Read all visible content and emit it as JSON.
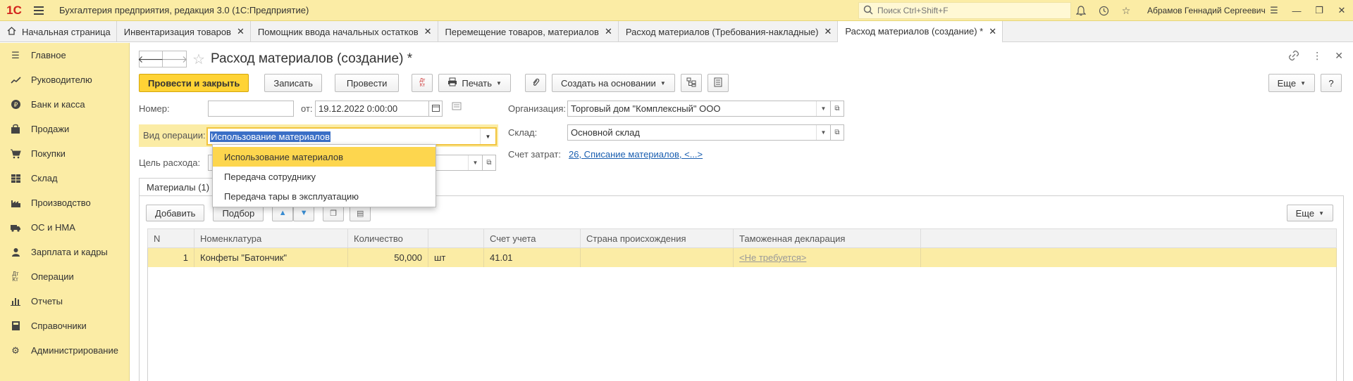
{
  "app": {
    "logo": "1С",
    "title": "Бухгалтерия предприятия, редакция 3.0  (1С:Предприятие)",
    "search_placeholder": "Поиск Ctrl+Shift+F",
    "user": "Абрамов Геннадий Сергеевич"
  },
  "tabs": [
    {
      "label": "Начальная страница"
    },
    {
      "label": "Инвентаризация товаров"
    },
    {
      "label": "Помощник ввода начальных остатков"
    },
    {
      "label": "Перемещение товаров, материалов"
    },
    {
      "label": "Расход материалов (Требования-накладные)"
    },
    {
      "label": "Расход материалов (создание) *"
    }
  ],
  "sidebar": {
    "items": [
      {
        "label": "Главное"
      },
      {
        "label": "Руководителю"
      },
      {
        "label": "Банк и касса"
      },
      {
        "label": "Продажи"
      },
      {
        "label": "Покупки"
      },
      {
        "label": "Склад"
      },
      {
        "label": "Производство"
      },
      {
        "label": "ОС и НМА"
      },
      {
        "label": "Зарплата и кадры"
      },
      {
        "label": "Операции"
      },
      {
        "label": "Отчеты"
      },
      {
        "label": "Справочники"
      },
      {
        "label": "Администрирование"
      }
    ]
  },
  "doc": {
    "title": "Расход материалов (создание) *"
  },
  "toolbar": {
    "post_close": "Провести и закрыть",
    "save": "Записать",
    "post": "Провести",
    "dtkt": "Дт Кт",
    "print": "Печать",
    "create_based": "Создать на основании",
    "more": "Еще",
    "help": "?"
  },
  "form": {
    "number_label": "Номер:",
    "number_value": "",
    "date_label": "от:",
    "date_value": "19.12.2022  0:00:00",
    "org_label": "Организация:",
    "org_value": "Торговый дом \"Комплексный\" ООО",
    "optype_label": "Вид операции:",
    "optype_value": "Использование материалов",
    "warehouse_label": "Склад:",
    "warehouse_value": "Основной склад",
    "purpose_label": "Цель расхода:",
    "cost_account_label": "Счет затрат:",
    "cost_account_value": "26, Списание материалов, <...>"
  },
  "dropdown": {
    "options": [
      "Использование материалов",
      "Передача сотруднику",
      "Передача тары в эксплуатацию"
    ]
  },
  "materials": {
    "tab_label": "Материалы (1)",
    "add": "Добавить",
    "pick": "Подбор",
    "more": "Еще",
    "columns": [
      "N",
      "Номенклатура",
      "Количество",
      "",
      "Счет учета",
      "Страна происхождения",
      "Таможенная декларация"
    ],
    "rows": [
      {
        "n": "1",
        "item": "Конфеты \"Батончик\"",
        "qty": "50,000",
        "unit": "шт",
        "account": "41.01",
        "country": "",
        "customs": "<Не требуется>"
      }
    ]
  }
}
